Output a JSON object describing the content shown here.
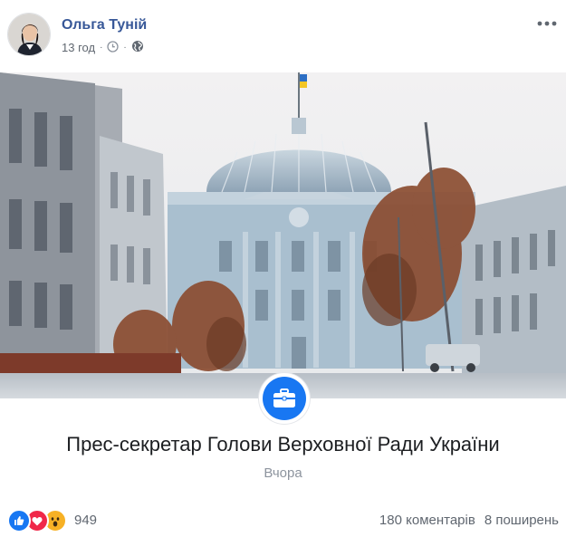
{
  "post": {
    "author": "Ольга Туній",
    "time": "13 год",
    "separator": "·"
  },
  "page_card": {
    "title": "Прес-секретар Голови Верховної Ради України",
    "date": "Вчора"
  },
  "engagement": {
    "reaction_count": "949",
    "comments": "180 коментарів",
    "shares": "8 поширень"
  },
  "icons": [
    "avatar",
    "clock-icon",
    "globe-icon",
    "more-options-icon",
    "briefcase-icon",
    "like-reaction-icon",
    "love-reaction-icon",
    "wow-reaction-icon"
  ],
  "colors": {
    "author": "#385898",
    "badge": "#1877f2",
    "like": "#1877f2",
    "love": "#f02849",
    "wow": "#f7b125",
    "meta_text": "#606770"
  }
}
